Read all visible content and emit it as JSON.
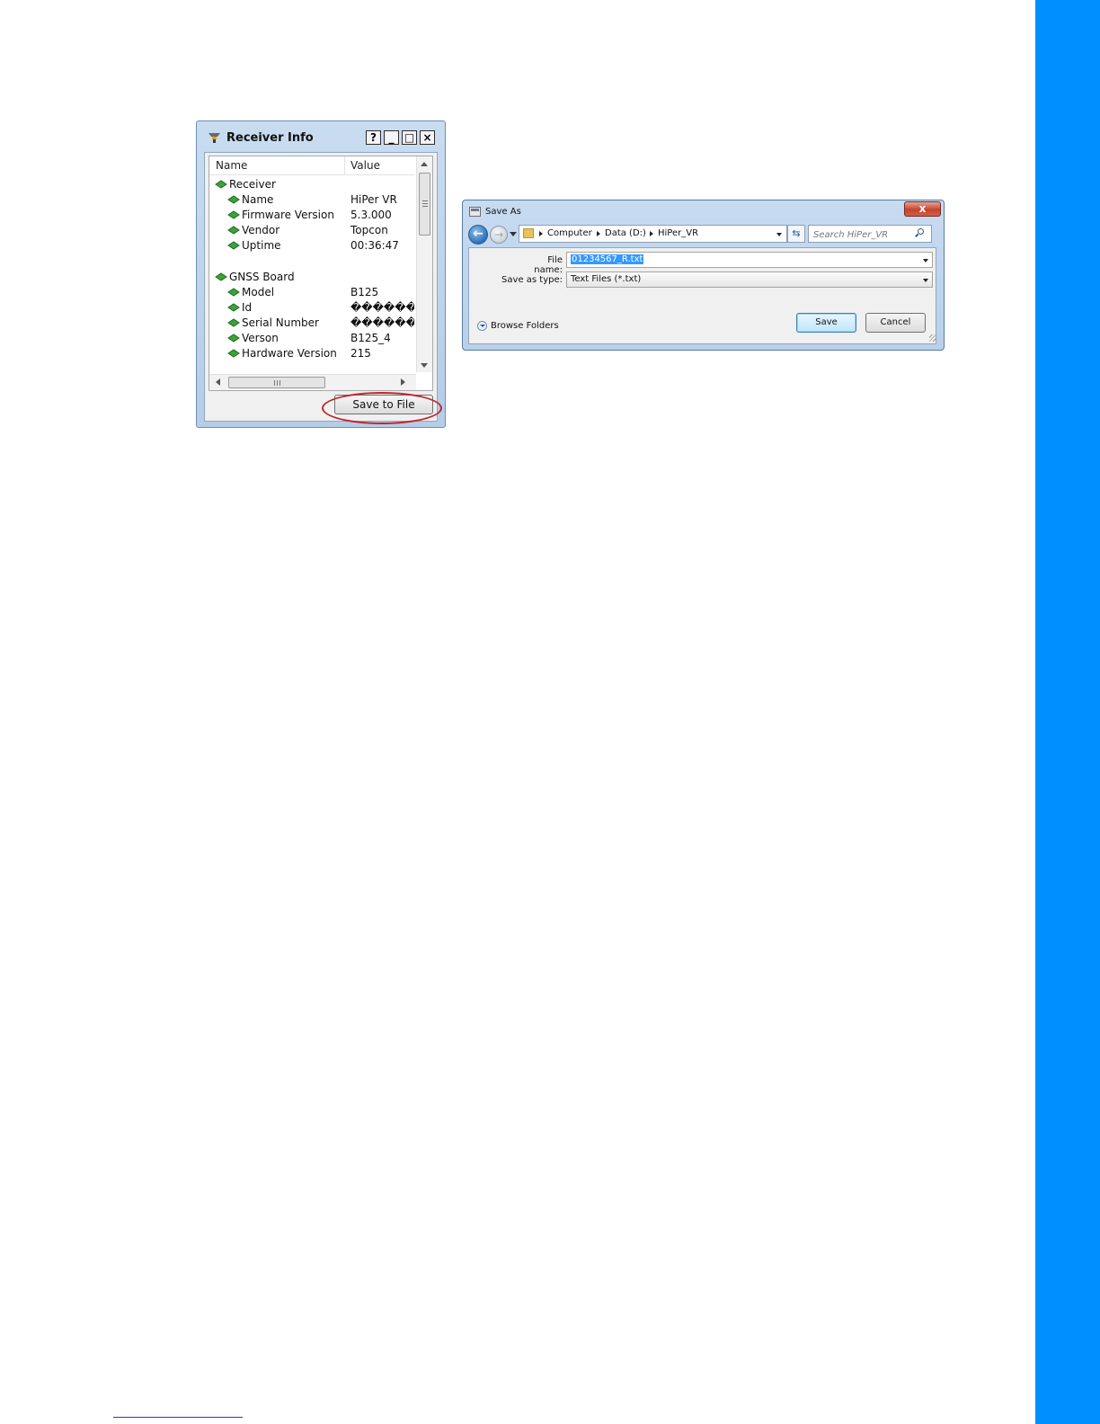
{
  "receiver_info": {
    "title": "Receiver Info",
    "title_buttons": {
      "help": "?",
      "minimize": "_",
      "maximize": "□",
      "close": "×"
    },
    "columns": {
      "name": "Name",
      "value": "Value"
    },
    "groups": [
      {
        "label": "Receiver",
        "items": [
          {
            "name": "Name",
            "value": "HiPer VR"
          },
          {
            "name": "Firmware Version",
            "value": "5.3.000"
          },
          {
            "name": "Vendor",
            "value": "Topcon"
          },
          {
            "name": "Uptime",
            "value": "00:36:47"
          }
        ]
      },
      {
        "label": "GNSS Board",
        "items": [
          {
            "name": "Model",
            "value": "B125"
          },
          {
            "name": "Id",
            "value": "�������"
          },
          {
            "name": "Serial Number",
            "value": "�������"
          },
          {
            "name": "Verson",
            "value": "B125_4"
          },
          {
            "name": "Hardware Version",
            "value": "215"
          }
        ]
      }
    ],
    "save_button": "Save to File",
    "colors": {
      "highlight": "#c0262c",
      "node": "#3aa33a"
    }
  },
  "save_as": {
    "title": "Save As",
    "close_glyph": "x",
    "breadcrumb": [
      "Computer",
      "Data (D:)",
      "HiPer_VR"
    ],
    "search_placeholder": "Search HiPer_VR",
    "file_name_label": "File name:",
    "file_name_value": "01234567_R.txt",
    "save_type_label": "Save as type:",
    "save_type_value": "Text Files (*.txt)",
    "browse_folders": "Browse Folders",
    "save_button": "Save",
    "cancel_button": "Cancel"
  },
  "page": {
    "accent_color": "#008ffe"
  }
}
